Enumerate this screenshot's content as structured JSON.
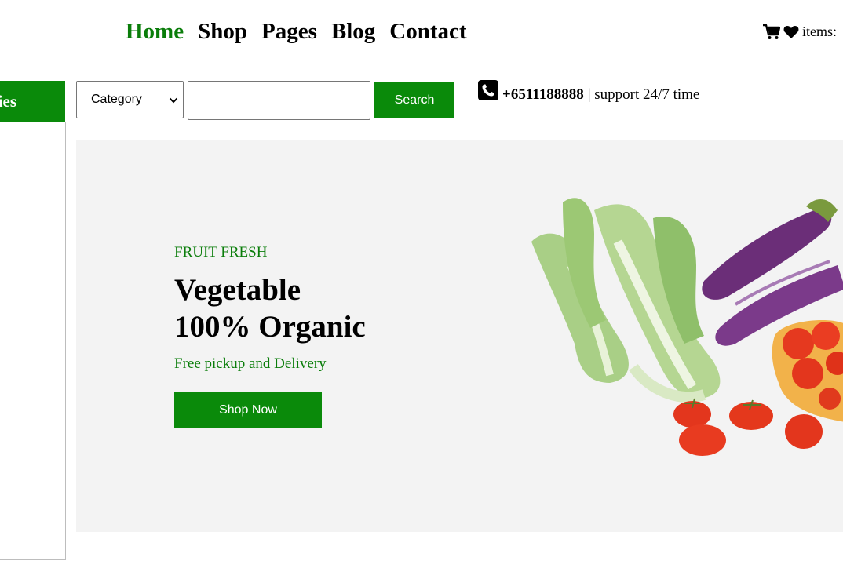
{
  "nav": {
    "items": [
      {
        "label": "Home",
        "active": true
      },
      {
        "label": "Shop",
        "active": false
      },
      {
        "label": "Pages",
        "active": false
      },
      {
        "label": "Blog",
        "active": false
      },
      {
        "label": "Contact",
        "active": false
      }
    ]
  },
  "header": {
    "cart_icon": "cart-icon",
    "wishlist_icon": "heart-icon",
    "items_label": "items:"
  },
  "sidebar": {
    "heading": "ies"
  },
  "search": {
    "category_value": "Category",
    "input_value": "",
    "button_label": "Search"
  },
  "contact": {
    "phone_icon": "phone-icon",
    "phone": "+6511188888",
    "support": "| support 24/7 time"
  },
  "hero": {
    "subtitle": "FRUIT FRESH",
    "title_line1": "Vegetable",
    "title_line2": "100% Organic",
    "description": "Free pickup and Delivery",
    "button_label": "Shop Now",
    "image": "vegetables-image"
  },
  "colors": {
    "brand_green": "#0a8a0a",
    "hero_bg": "#f3f3f3"
  }
}
